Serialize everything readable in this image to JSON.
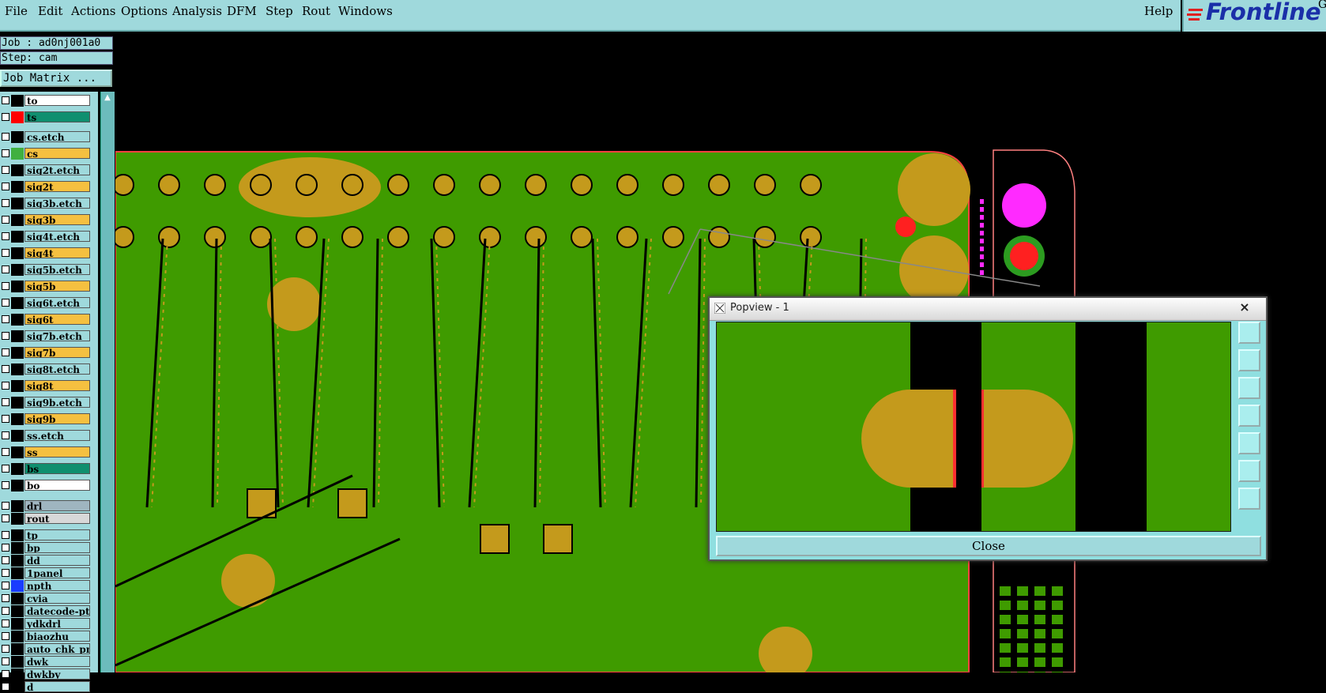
{
  "menu": {
    "items": [
      "File",
      "Edit",
      "Actions",
      "Options",
      "Analysis",
      "DFM",
      "Step",
      "Rout",
      "Windows"
    ],
    "help": "Help"
  },
  "logo": {
    "text": "Frontline",
    "superscript": "G"
  },
  "sidebar": {
    "job": "Job : ad0nj001a0",
    "step": "Step: cam",
    "job_matrix_label": "Job Matrix ..."
  },
  "layers": [
    {
      "name": "to",
      "fill": "#ffffff",
      "color": "#000000"
    },
    {
      "name": "ts",
      "fill": "#0f8f6f",
      "color": "#ff0000"
    },
    {
      "name": "cs.etch",
      "fill": "#9fd9dc",
      "color": "#000000"
    },
    {
      "name": "cs",
      "fill": "#f5c040",
      "color": "#40b040"
    },
    {
      "name": "sig2t.etch",
      "fill": "#9fd9dc",
      "color": "#000000"
    },
    {
      "name": "sig2t",
      "fill": "#f5c040",
      "color": "#000000"
    },
    {
      "name": "sig3b.etch",
      "fill": "#9fd9dc",
      "color": "#000000"
    },
    {
      "name": "sig3b",
      "fill": "#f5c040",
      "color": "#000000"
    },
    {
      "name": "sig4t.etch",
      "fill": "#9fd9dc",
      "color": "#000000"
    },
    {
      "name": "sig4t",
      "fill": "#f5c040",
      "color": "#000000"
    },
    {
      "name": "sig5b.etch",
      "fill": "#9fd9dc",
      "color": "#000000"
    },
    {
      "name": "sig5b",
      "fill": "#f5c040",
      "color": "#000000"
    },
    {
      "name": "sig6t.etch",
      "fill": "#9fd9dc",
      "color": "#000000"
    },
    {
      "name": "sig6t",
      "fill": "#f5c040",
      "color": "#000000"
    },
    {
      "name": "sig7b.etch",
      "fill": "#9fd9dc",
      "color": "#000000"
    },
    {
      "name": "sig7b",
      "fill": "#f5c040",
      "color": "#000000"
    },
    {
      "name": "sig8t.etch",
      "fill": "#9fd9dc",
      "color": "#000000"
    },
    {
      "name": "sig8t",
      "fill": "#f5c040",
      "color": "#000000"
    },
    {
      "name": "sig9b.etch",
      "fill": "#9fd9dc",
      "color": "#000000"
    },
    {
      "name": "sig9b",
      "fill": "#f5c040",
      "color": "#000000"
    },
    {
      "name": "ss.etch",
      "fill": "#9fd9dc",
      "color": "#000000"
    },
    {
      "name": "ss",
      "fill": "#f5c040",
      "color": "#000000"
    },
    {
      "name": "bs",
      "fill": "#0f8f6f",
      "color": "#000000"
    },
    {
      "name": "bo",
      "fill": "#ffffff",
      "color": "#000000"
    },
    {
      "name": "drl",
      "fill": "#9fb5c0",
      "color": "#000000"
    },
    {
      "name": "rout",
      "fill": "#d8d8d8",
      "color": "#000000"
    },
    {
      "name": "tp",
      "fill": "#9fd9dc",
      "color": "#000000"
    },
    {
      "name": "bp",
      "fill": "#9fd9dc",
      "color": "#000000"
    },
    {
      "name": "dd",
      "fill": "#9fd9dc",
      "color": "#000000"
    },
    {
      "name": "1panel",
      "fill": "#9fd9dc",
      "color": "#000000"
    },
    {
      "name": "npth",
      "fill": "#9fd9dc",
      "color": "#1a3cff"
    },
    {
      "name": "cvia",
      "fill": "#9fd9dc",
      "color": "#000000"
    },
    {
      "name": "datecode-pte",
      "fill": "#9fd9dc",
      "color": "#000000"
    },
    {
      "name": "ydkdrl",
      "fill": "#9fd9dc",
      "color": "#000000"
    },
    {
      "name": "biaozhu",
      "fill": "#9fd9dc",
      "color": "#000000"
    },
    {
      "name": "auto_chk_pnl",
      "fill": "#9fd9dc",
      "color": "#000000"
    },
    {
      "name": "dwk",
      "fill": "#9fd9dc",
      "color": "#000000"
    },
    {
      "name": "dwkby",
      "fill": "#9fd9dc",
      "color": "#000000"
    },
    {
      "name": "d",
      "fill": "#9fd9dc",
      "color": "#000000"
    }
  ],
  "popview": {
    "title": "Popview - 1",
    "close_x": "×",
    "close_label": "Close"
  },
  "colors": {
    "board": "#3f9b00",
    "pad": "#c49a1c",
    "trace_gap": "#000000",
    "outline": "#ff4040",
    "marker": "#ff2aff",
    "menu_bg": "#9fd9dc"
  }
}
